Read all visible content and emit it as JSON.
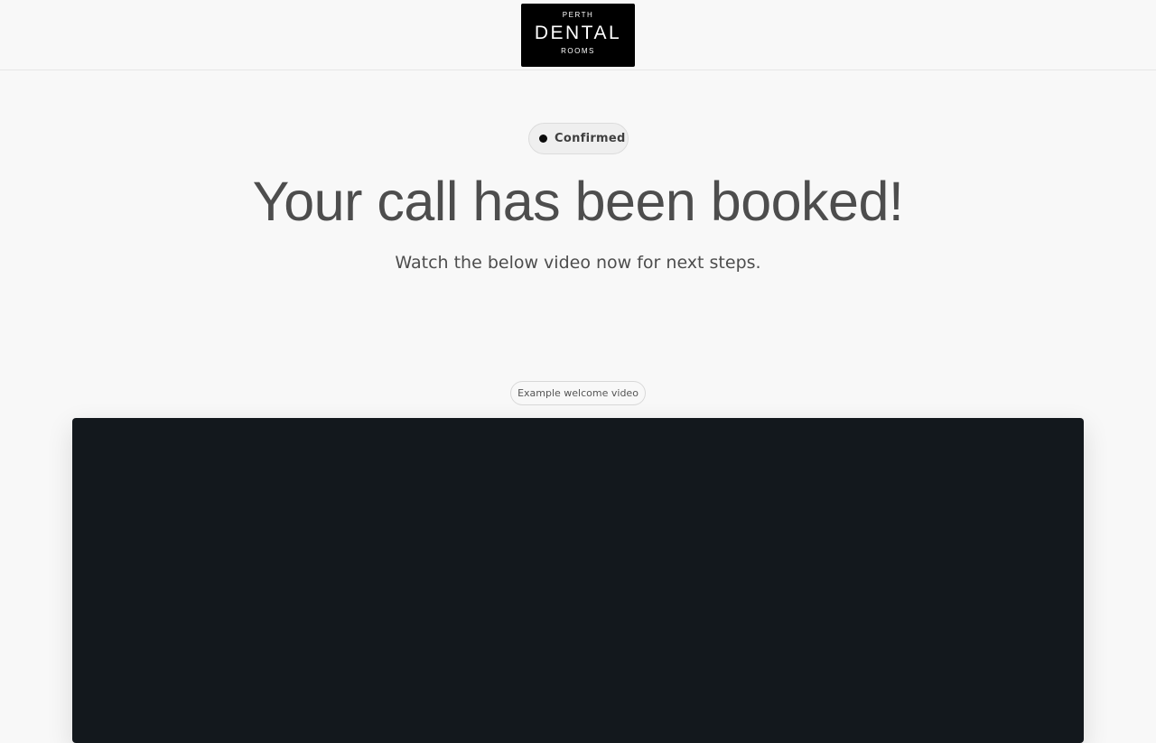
{
  "header": {
    "logo": {
      "top": "PERTH",
      "main": "DENTAL",
      "bottom": "ROOMS"
    }
  },
  "status_badge": {
    "label": "Confirmed"
  },
  "main": {
    "headline": "Your call has been booked!",
    "subline": "Watch the below video now for next steps."
  },
  "video": {
    "tag_label": "Example welcome video"
  },
  "colors": {
    "background": "#f8f8f8",
    "logo_background": "#000000",
    "text": "#4d4d4d",
    "video_background": "#13181d"
  }
}
